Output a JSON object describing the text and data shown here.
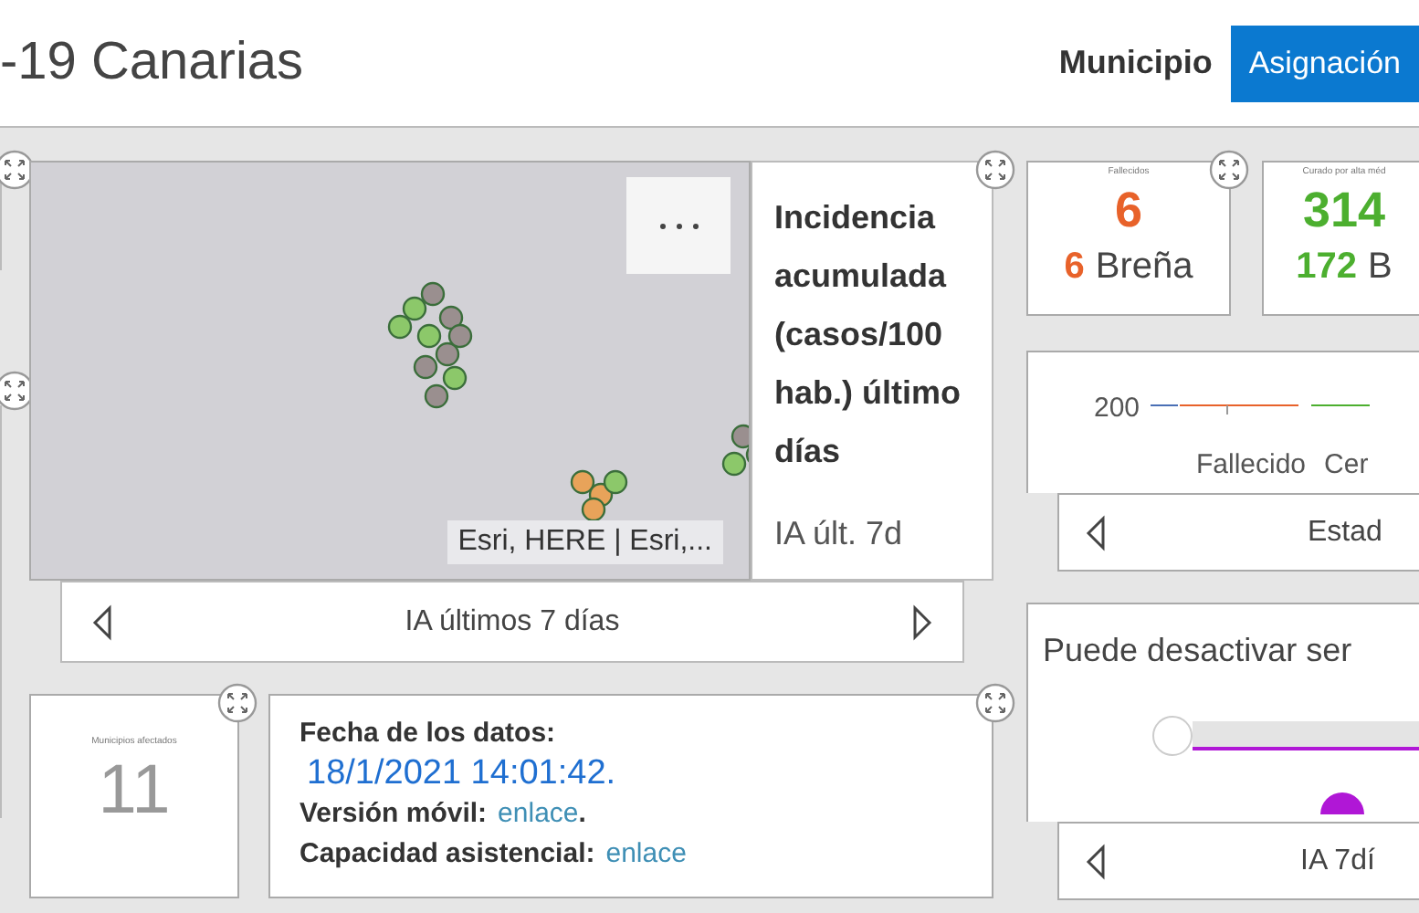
{
  "header": {
    "title": "-19 Canarias",
    "tabs": [
      {
        "label": "Municipio",
        "selected": false
      },
      {
        "label": "Asignación",
        "selected": true
      }
    ]
  },
  "map": {
    "attribution": "Esri, HERE | Esri,...",
    "nav_label": "IA últimos 7 días"
  },
  "legend": {
    "title_lines": [
      "Incidencia",
      "acumulada",
      "(casos/100",
      "hab.) último",
      "días"
    ],
    "layer": "IA últ. 7d"
  },
  "kpis": [
    {
      "caption": "Fallecidos",
      "value": "6",
      "detail_value": "6",
      "detail_label": "Breña",
      "color": "#e8622a"
    },
    {
      "caption": "Curado por alta méd",
      "value": "314",
      "detail_value": "172",
      "detail_label": "B",
      "color": "#4caf2f"
    }
  ],
  "chart": {
    "tick": "200",
    "categories": [
      "Fallecido",
      "Cer"
    ],
    "nav_label": "Estad"
  },
  "filter": {
    "text": "Puede desactivar ser",
    "nav_label": "IA 7dí"
  },
  "count_card": {
    "caption": "Municipios afectados",
    "value": "11"
  },
  "info": {
    "date_label": "Fecha de los datos:",
    "date": "18/1/2021 14:01:42.",
    "links": [
      {
        "label": "Versión móvil:",
        "link": "enlace",
        "after": "."
      },
      {
        "label": "Capacidad asistencial:",
        "link": "enlace"
      }
    ]
  }
}
